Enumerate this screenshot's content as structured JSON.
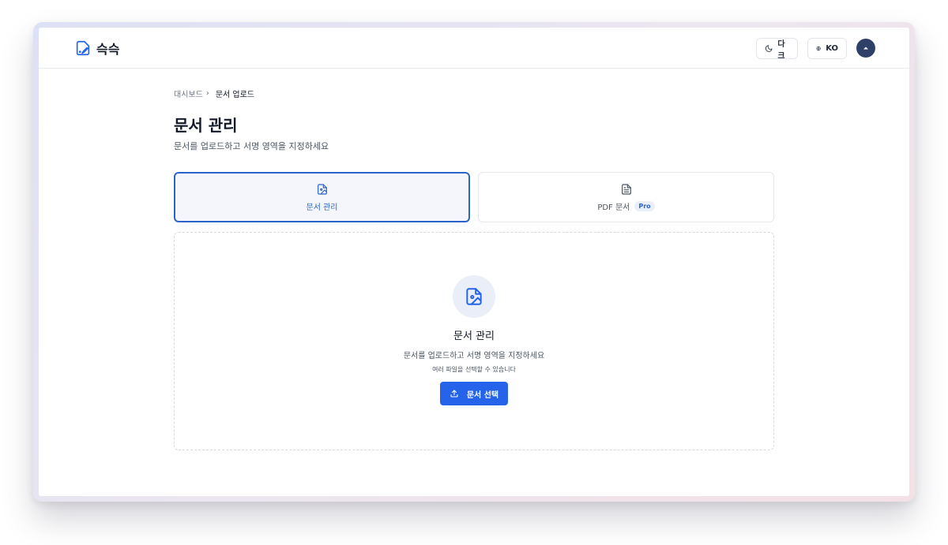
{
  "app": {
    "name": "슥슥"
  },
  "header": {
    "theme_label": "다크",
    "lang_label": "KO"
  },
  "breadcrumb": {
    "home": "대시보드",
    "current": "문서 업로드"
  },
  "page": {
    "title": "문서 관리",
    "subtitle": "문서를 업로드하고 서명 영역을 지정하세요"
  },
  "tabs": [
    {
      "label": "문서 관리",
      "active": true,
      "icon": "file-image-icon"
    },
    {
      "label": "PDF 문서",
      "badge": "Pro",
      "active": false,
      "icon": "file-text-icon"
    }
  ],
  "dropzone": {
    "title": "문서 관리",
    "description": "문서를 업로드하고 서명 영역을 지정하세요",
    "hint": "여러 파일을 선택할 수 있습니다",
    "button_label": "문서 선택"
  },
  "colors": {
    "accent": "#2563eb",
    "active_border": "#2b65c7",
    "avatar": "#2f4068"
  }
}
